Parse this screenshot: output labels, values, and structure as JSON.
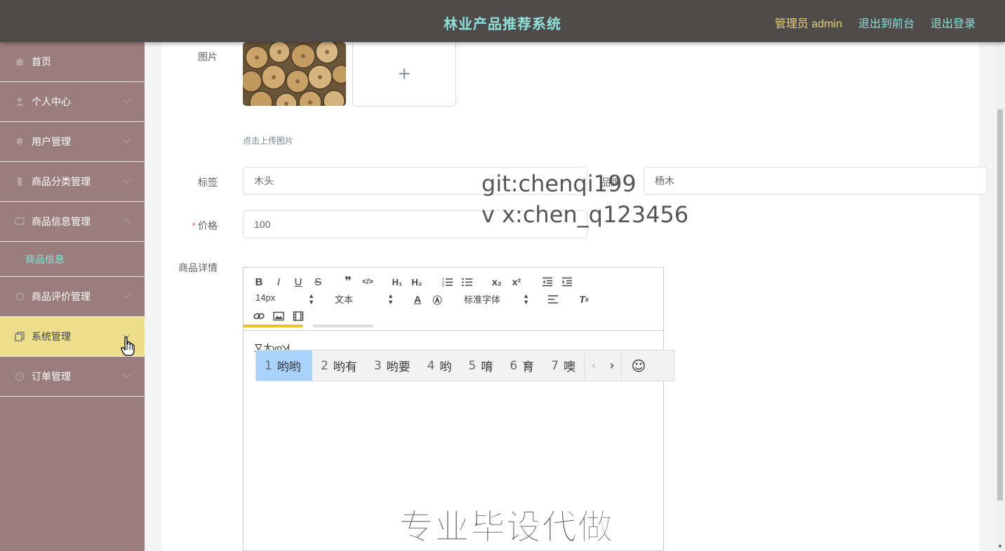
{
  "header": {
    "title": "林业产品推荐系统",
    "admin_label": "管理员 admin",
    "to_front": "退出到前台",
    "logout": "退出登录"
  },
  "sidebar": {
    "items": [
      {
        "label": "首页",
        "icon": "home-icon"
      },
      {
        "label": "个人中心",
        "icon": "user-icon"
      },
      {
        "label": "用户管理",
        "icon": "bell-icon"
      },
      {
        "label": "商品分类管理",
        "icon": "phone-icon"
      },
      {
        "label": "商品信息管理",
        "icon": "monitor-icon",
        "expanded": true
      },
      {
        "label": "商品评价管理",
        "icon": "circle-icon"
      },
      {
        "label": "系统管理",
        "icon": "copy-icon",
        "active": true
      },
      {
        "label": "订单管理",
        "icon": "clock-icon"
      }
    ],
    "submenu": {
      "label": "商品信息"
    }
  },
  "form": {
    "image_label": "图片",
    "upload_tip": "点击上传图片",
    "tag_label": "标签",
    "tag_value": "木头",
    "brand_label": "品牌",
    "brand_value": "杨木",
    "price_label": "价格",
    "price_value": "100",
    "detail_label": "商品详情"
  },
  "editor": {
    "font_size": "14px",
    "block_type": "文本",
    "font_family": "标准字体",
    "content_text": "又大",
    "content_pinyin": "yo'y"
  },
  "ime": {
    "candidates": [
      {
        "num": "1",
        "text": "哟哟"
      },
      {
        "num": "2",
        "text": "哟有"
      },
      {
        "num": "3",
        "text": "哟要"
      },
      {
        "num": "4",
        "text": "哟"
      },
      {
        "num": "5",
        "text": "唷"
      },
      {
        "num": "6",
        "text": "育"
      },
      {
        "num": "7",
        "text": "噢"
      }
    ],
    "selected_index": 0
  },
  "watermark": {
    "line1": "git:chenqi199",
    "line2": "v x:chen_q123456",
    "bottom": "专业毕设代做"
  },
  "colors": {
    "header_bg": "#4e4a4a",
    "title": "#8fe0d8",
    "admin": "#e8d37a",
    "sidebar_bg": "#9a7d7d",
    "sidebar_active": "#ecde8a",
    "ime_selected": "#a9d3fa"
  }
}
